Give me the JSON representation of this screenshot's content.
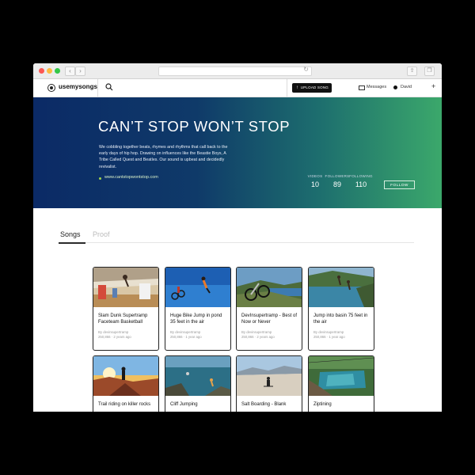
{
  "browser": {
    "back": "‹",
    "forward": "›",
    "reload": "↻",
    "share": "⇪",
    "tabs": "❐"
  },
  "header": {
    "logo_text": "usemysongs",
    "upload_label": "UPLOAD SONG",
    "upload_icon": "↑",
    "messages_label": "Messages",
    "user_name": "David",
    "plus": "+"
  },
  "hero": {
    "title": "CAN’T STOP WON’T STOP",
    "description": "We cobbling together beats, rhymes and rhythms that call back to the early days of hip hop. Drawing on influences like the Beastie Boys, A Tribe Called Quest and Beatles. Our sound is upbeat and decidedly revivalist.",
    "link": "www.cantstopwontstop.com",
    "stats": [
      {
        "label": "VIDEOS",
        "value": "10"
      },
      {
        "label": "FOLLOWERS",
        "value": "89"
      },
      {
        "label": "FOLLOWING",
        "value": "110"
      }
    ],
    "follow_label": "FOLLOW"
  },
  "tabs": [
    {
      "label": "Songs",
      "active": true
    },
    {
      "label": "Proof",
      "active": false
    }
  ],
  "songs": [
    {
      "title": "Slam Dunk Supertramp Faceteam Basketball",
      "author": "By devinsupertramp",
      "meta": "250,866 · 2 years ago"
    },
    {
      "title": "Huge Bike Jump in pond 35 feet in the air",
      "author": "By devinsupertramp",
      "meta": "250,866 · 1 year ago"
    },
    {
      "title": "DevInsupertramp - Best of Now or Never",
      "author": "By devinsupertramp",
      "meta": "250,866 · 2 years ago"
    },
    {
      "title": "Jump into basin 75 feet in the air",
      "author": "By devinsupertramp",
      "meta": "250,866 · 1 year ago"
    },
    {
      "title": "Trail riding on killer rocks",
      "author": "",
      "meta": ""
    },
    {
      "title": "Cliff Jumping",
      "author": "",
      "meta": ""
    },
    {
      "title": "Salt Boarding - Blank",
      "author": "",
      "meta": ""
    },
    {
      "title": "Ziptining",
      "author": "",
      "meta": ""
    }
  ],
  "colors": {
    "hero_start": "#0b2a66",
    "hero_end": "#3ba86b",
    "link_dot": "#a2d64a",
    "upload_bg": "#111111"
  }
}
